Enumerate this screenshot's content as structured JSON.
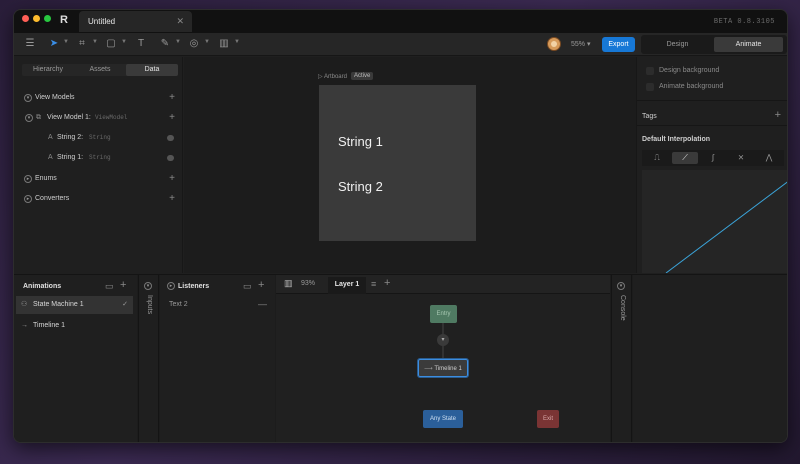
{
  "titlebar": {
    "doc_name": "Untitled",
    "close": "✕",
    "version": "BETA 0.8.3105"
  },
  "toolbar": {
    "zoom": "55%",
    "export_label": "Export",
    "mode_design": "Design",
    "mode_animate": "Animate"
  },
  "left_panel": {
    "tabs": [
      "Hierarchy",
      "Assets",
      "Data"
    ],
    "active_tab": "Data",
    "view_models_label": "View Models",
    "view_model_1": {
      "label": "View Model 1:",
      "type": "ViewModel"
    },
    "string_2": {
      "label": "String 2:",
      "type": "String"
    },
    "string_1": {
      "label": "String 1:",
      "type": "String"
    },
    "enums_label": "Enums",
    "converters_label": "Converters"
  },
  "canvas": {
    "artboard_label": "Artboard",
    "active_badge": "Active",
    "text_1": "String 1",
    "text_2": "String 2"
  },
  "right_panel": {
    "design_bg": "Design background",
    "animate_bg": "Animate background",
    "tags_label": "Tags",
    "interp_label": "Default Interpolation"
  },
  "bottom": {
    "animations_title": "Animations",
    "state_machine": "State Machine 1",
    "timeline": "Timeline 1",
    "inputs_label": "Inputs",
    "listeners_title": "Listeners",
    "listener_item": "Text 2",
    "graph_zoom": "93%",
    "layer_tab": "Layer 1",
    "console_label": "Console",
    "nodes": {
      "entry": "Entry",
      "timeline": "Timeline 1",
      "any_state": "Any State",
      "exit": "Exit"
    }
  },
  "colors": {
    "accent": "#1778d6",
    "entry": "#4f7a62",
    "any_state": "#2b5f9a",
    "exit": "#7a3434",
    "curve": "#3aa3d8"
  }
}
